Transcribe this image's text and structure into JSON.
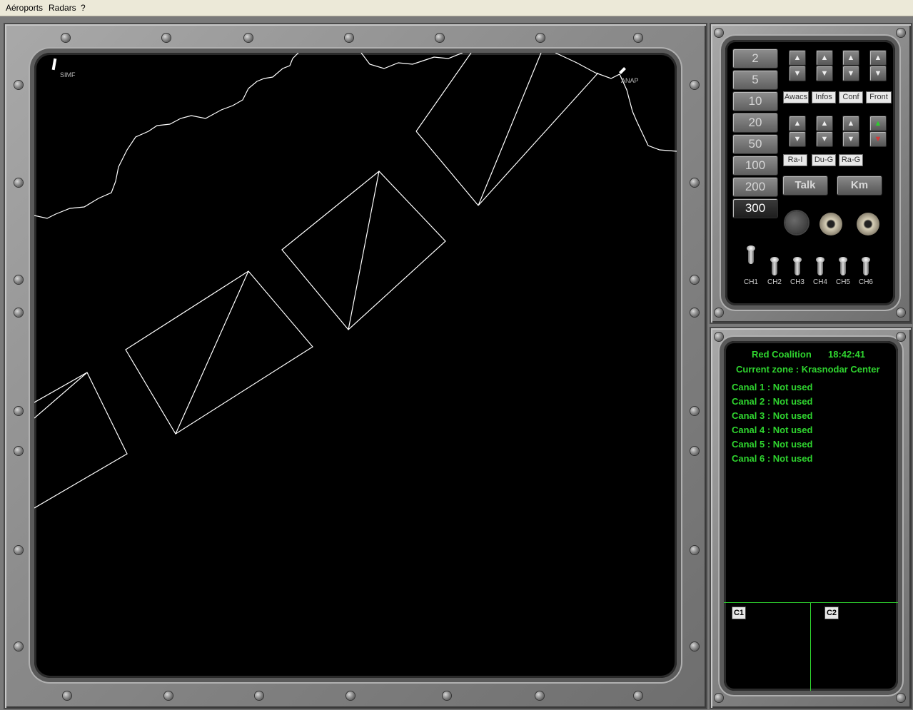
{
  "menu": {
    "items": [
      "Aéroports",
      "Radars",
      "?"
    ]
  },
  "map": {
    "labels": {
      "top_left_cut": "SIMF",
      "simf": "SIMF",
      "anap": "ANAP"
    }
  },
  "zoom": {
    "values": [
      "2",
      "5",
      "10",
      "20",
      "50",
      "100",
      "200",
      "300"
    ],
    "selected": "300"
  },
  "controls": {
    "top_labels": [
      "Awacs",
      "Infos",
      "Conf",
      "Front"
    ],
    "mid_labels": [
      "Ra-I",
      "Du-G",
      "Ra-G"
    ],
    "talk_label": "Talk",
    "km_label": "Km",
    "channels": [
      "CH1",
      "CH2",
      "CH3",
      "CH4",
      "CH5",
      "CH6"
    ]
  },
  "info": {
    "coalition": "Red Coalition",
    "time": "18:42:41",
    "zone": "Current zone : Krasnodar Center",
    "canals": [
      "Canal 1 : Not used",
      "Canal 2 : Not used",
      "Canal 3 : Not used",
      "Canal 4 : Not used",
      "Canal 5 : Not used",
      "Canal 6 : Not used"
    ],
    "c1": "C1",
    "c2": "C2"
  },
  "colors": {
    "info_text": "#2fd52f",
    "screen": "#000000",
    "frame": "#8a8a8a"
  }
}
